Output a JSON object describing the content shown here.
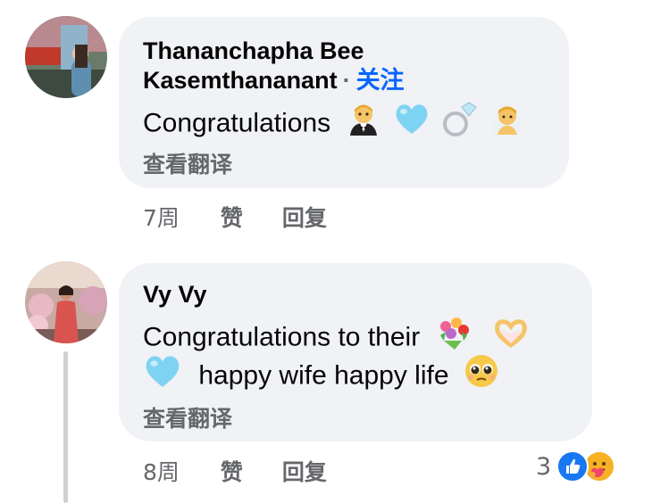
{
  "comments": [
    {
      "author": "Thananchapha Bee Kasemthananant",
      "author_line1": "Thananchapha Bee",
      "author_line2": "Kasemthananant",
      "separator": "·",
      "follow_label": "关注",
      "text": "Congratulations",
      "emojis": [
        "man-in-tuxedo-emoji",
        "light-blue-heart-emoji",
        "ring-emoji",
        "bride-with-veil-emoji"
      ],
      "translate_label": "查看翻译",
      "time": "7周",
      "like_label": "赞",
      "reply_label": "回复"
    },
    {
      "author": "Vy Vy",
      "text_line1": "Congratulations to their",
      "text_line2": "happy wife happy life",
      "emojis_line1": [
        "bouquet-emoji",
        "heart-hands-emoji"
      ],
      "emojis_line2_lead": [
        "light-blue-heart-emoji"
      ],
      "emojis_line2_trail": [
        "pleading-face-emoji"
      ],
      "translate_label": "查看翻译",
      "time": "8周",
      "like_label": "赞",
      "reply_label": "回复",
      "reaction_count": "3",
      "reactions": [
        "like-reaction-icon",
        "care-reaction-icon"
      ]
    }
  ],
  "colors": {
    "bubble": "#f0f2f5",
    "follow": "#0866ff",
    "meta": "#65676b",
    "thread_line": "#ced0d4"
  }
}
